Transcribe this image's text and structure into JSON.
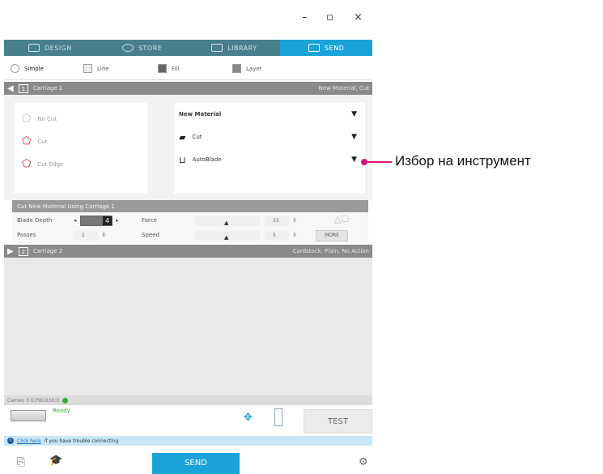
{
  "window": {
    "minimize_icon": "minimize-icon",
    "restore_icon": "restore-icon",
    "close_icon": "close-icon",
    "minimize": "–",
    "restore": "▫",
    "close": "×"
  },
  "nav": {
    "tabs": [
      {
        "label": "DESIGN",
        "icon": "design-icon"
      },
      {
        "label": "STORE",
        "icon": "store-icon"
      },
      {
        "label": "LIBRARY",
        "icon": "library-icon"
      },
      {
        "label": "SEND",
        "icon": "send-icon",
        "active": true
      }
    ]
  },
  "modes": [
    {
      "label": "Simple"
    },
    {
      "label": "Line"
    },
    {
      "label": "Fill"
    },
    {
      "label": "Layer"
    }
  ],
  "carriage1": {
    "num": "1",
    "title": "Carriage 1",
    "right": "New Material, Cut"
  },
  "cut_options": [
    {
      "label": "No Cut"
    },
    {
      "label": "Cut"
    },
    {
      "label": "Cut Edge"
    }
  ],
  "material": {
    "value": "New Material",
    "action": "Cut",
    "tool": "AutoBlade",
    "arrow": "▼"
  },
  "cut_bar": "Cut New Material Using Carriage 1",
  "settings": {
    "blade_depth_label": "Blade Depth",
    "blade_depth_value": "4",
    "force_label": "Force",
    "force_value": "33",
    "passes_label": "Passes",
    "passes_value": "1",
    "speed_label": "Speed",
    "speed_value": "5",
    "more_label": "MORE"
  },
  "carriage2": {
    "num": "2",
    "title": "Carriage 2",
    "right": "Cardstock, Plain, No Action"
  },
  "status": {
    "text": "Cameo 3 (CP8C6303)"
  },
  "machine": {
    "state": "Ready",
    "test_label": "TEST"
  },
  "help": {
    "link": "Click here",
    "text": "if you have trouble connecting"
  },
  "bottom": {
    "send_label": "SEND"
  },
  "callout": {
    "text": "Избор на инструмент",
    "color": "#d4147a"
  },
  "colors": {
    "accent": "#1aa3d6",
    "nav": "#4a7f8c",
    "cut_red": "#d0202d"
  }
}
